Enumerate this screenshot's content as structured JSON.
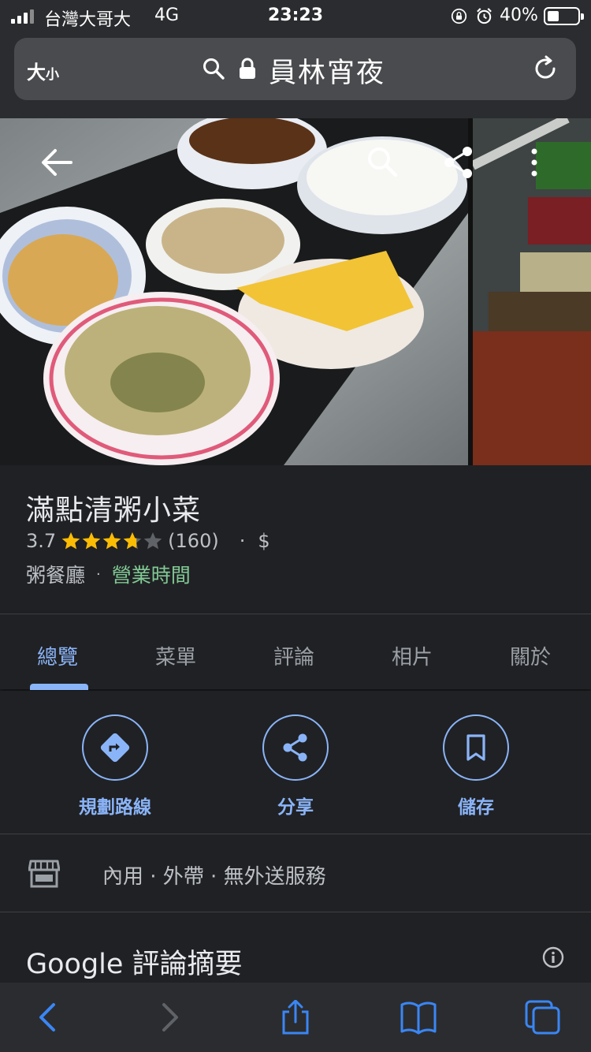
{
  "status_bar": {
    "carrier": "台灣大哥大",
    "network": "4G",
    "time": "23:23",
    "battery": "40%",
    "battery_level": 0.4
  },
  "browser": {
    "text_size_big": "大",
    "text_size_small": "小",
    "address": "員林宵夜"
  },
  "place": {
    "name": "滿點清粥小菜",
    "rating": "3.7",
    "rating_value": 3.7,
    "review_count": "(160)",
    "separator": "·",
    "price": "$",
    "category": "粥餐廳",
    "category_separator": "·",
    "hours_link": "營業時間"
  },
  "tabs": [
    {
      "label": "總覽",
      "active": true
    },
    {
      "label": "菜單",
      "active": false
    },
    {
      "label": "評論",
      "active": false
    },
    {
      "label": "相片",
      "active": false
    },
    {
      "label": "關於",
      "active": false
    }
  ],
  "actions": [
    {
      "label": "規劃路線",
      "icon": "directions-icon"
    },
    {
      "label": "分享",
      "icon": "share-icon"
    },
    {
      "label": "儲存",
      "icon": "bookmark-icon"
    }
  ],
  "service": {
    "icon": "store-icon",
    "text": "內用 · 外帶 · 無外送服務"
  },
  "reviews_summary": {
    "title": "Google 評論摘要"
  },
  "colors": {
    "accent": "#8ab4f8",
    "open_hours": "#81c995",
    "star": "#fbbc04",
    "background": "#202124"
  }
}
